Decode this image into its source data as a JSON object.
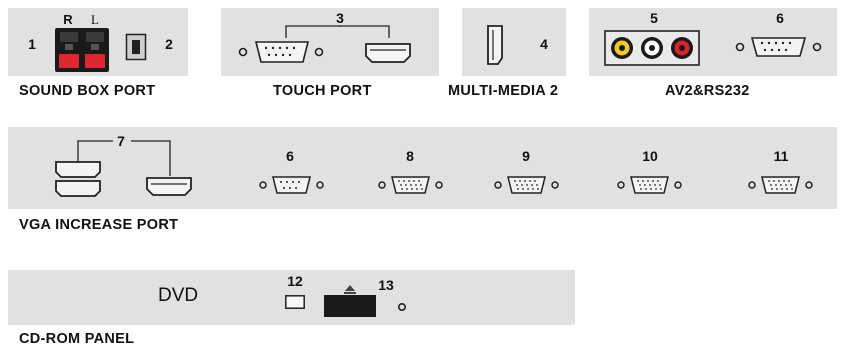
{
  "sections": {
    "sound_box": {
      "caption": "SOUND BOX PORT",
      "channel_r": "R",
      "channel_l": "L",
      "num_1": "1",
      "num_2": "2"
    },
    "touch": {
      "caption": "TOUCH PORT",
      "num_3": "3"
    },
    "multimedia": {
      "caption": "MULTI-MEDIA 2",
      "num_4": "4"
    },
    "av_rs232": {
      "caption": "AV2&RS232",
      "num_5": "5",
      "num_6": "6"
    },
    "vga_increase": {
      "caption": "VGA INCREASE PORT",
      "num_7": "7",
      "num_6": "6",
      "num_8": "8",
      "num_9": "9",
      "num_10": "10",
      "num_11": "11"
    },
    "cdrom": {
      "caption": "CD-ROM PANEL",
      "label": "DVD",
      "num_12": "12",
      "num_13": "13"
    }
  },
  "colors": {
    "panel": "#e1e1e1",
    "speaker_red": "#e0262e",
    "rca_yellow": "#f2cc1a",
    "rca_white": "#ffffff",
    "rca_red": "#d8242c",
    "ink": "#111111"
  }
}
